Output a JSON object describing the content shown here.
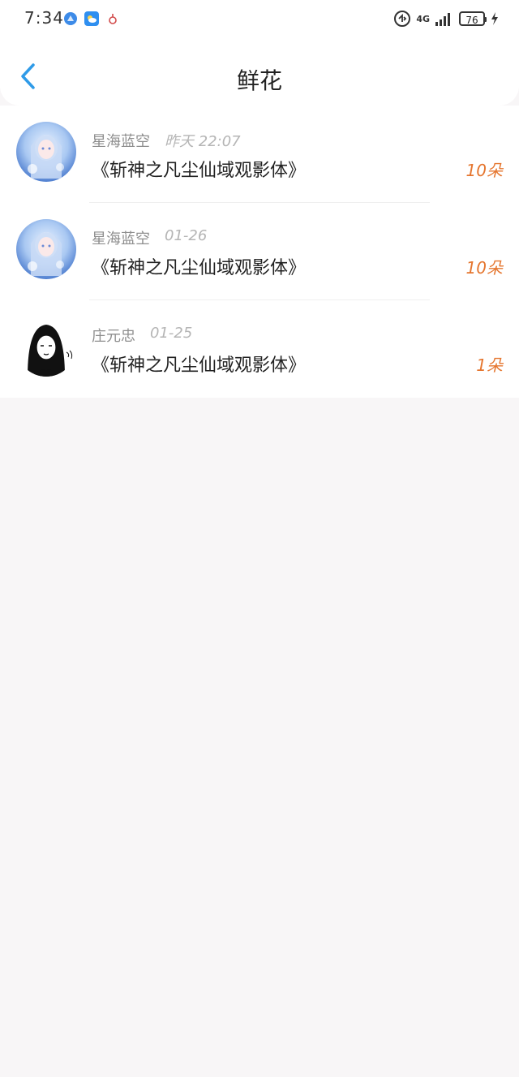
{
  "status_bar": {
    "time": "7:34",
    "battery": "76",
    "network": "4G",
    "icons": [
      "compass-icon",
      "weather-icon",
      "notification-icon",
      "volte-icon",
      "signal-icon",
      "charging-icon"
    ]
  },
  "header": {
    "title": "鲜花",
    "back_icon": "chevron-left-icon"
  },
  "items": [
    {
      "name": "星海蓝空",
      "time": "昨天 22:07",
      "title": "《斩神之凡尘仙域观影体》",
      "count": "10朵",
      "avatar": "anime-avatar"
    },
    {
      "name": "星海蓝空",
      "time": "01-26",
      "title": "《斩神之凡尘仙域观影体》",
      "count": "10朵",
      "avatar": "anime-avatar"
    },
    {
      "name": "庄元忠",
      "time": "01-25",
      "title": "《斩神之凡尘仙域观影体》",
      "count": "1朵",
      "avatar": "sketch-avatar"
    }
  ],
  "colors": {
    "accent": "#2f9be8",
    "count": "#e5762f",
    "background": "#f8f6f7"
  }
}
